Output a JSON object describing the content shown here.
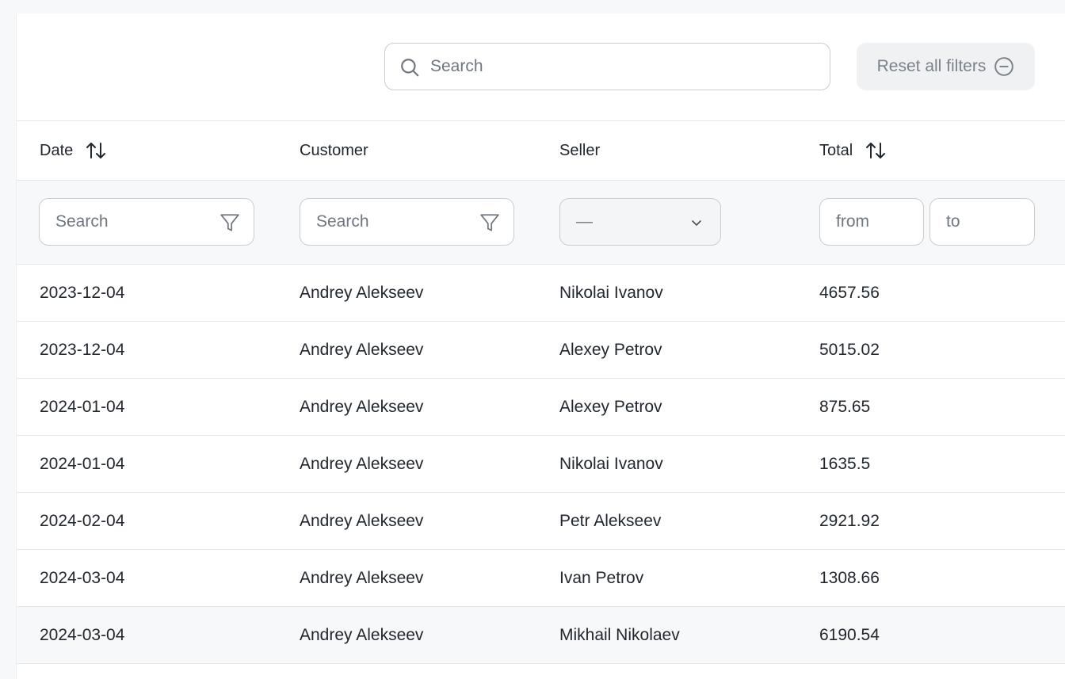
{
  "toolbar": {
    "search_placeholder": "Search",
    "reset_label": "Reset all filters"
  },
  "columns": [
    {
      "label": "Date",
      "sortable": true
    },
    {
      "label": "Customer",
      "sortable": false
    },
    {
      "label": "Seller",
      "sortable": false
    },
    {
      "label": "Total",
      "sortable": true
    }
  ],
  "filters": {
    "date_placeholder": "Search",
    "customer_placeholder": "Search",
    "seller_value": "—",
    "total_from_placeholder": "from",
    "total_to_placeholder": "to"
  },
  "rows": [
    {
      "date": "2023-12-04",
      "customer": "Andrey Alekseev",
      "seller": "Nikolai Ivanov",
      "total": "4657.56"
    },
    {
      "date": "2023-12-04",
      "customer": "Andrey Alekseev",
      "seller": "Alexey Petrov",
      "total": "5015.02"
    },
    {
      "date": "2024-01-04",
      "customer": "Andrey Alekseev",
      "seller": "Alexey Petrov",
      "total": "875.65"
    },
    {
      "date": "2024-01-04",
      "customer": "Andrey Alekseev",
      "seller": "Nikolai Ivanov",
      "total": "1635.5"
    },
    {
      "date": "2024-02-04",
      "customer": "Andrey Alekseev",
      "seller": "Petr Alekseev",
      "total": "2921.92"
    },
    {
      "date": "2024-03-04",
      "customer": "Andrey Alekseev",
      "seller": "Ivan Petrov",
      "total": "1308.66"
    },
    {
      "date": "2024-03-04",
      "customer": "Andrey Alekseev",
      "seller": "Mikhail Nikolaev",
      "total": "6190.54"
    }
  ],
  "icons": {
    "search": "search-icon",
    "reset": "minus-circle-icon",
    "sort": "sort-arrows-icon",
    "filter": "funnel-icon",
    "dropdown": "chevron-down-icon"
  },
  "colors": {
    "background": "#f7f8f9",
    "surface": "#ffffff",
    "border": "#c9cdd3",
    "divider": "#e5e7ea",
    "text": "#21272e",
    "muted": "#6f7680",
    "reset_bg": "#f0f1f3"
  }
}
